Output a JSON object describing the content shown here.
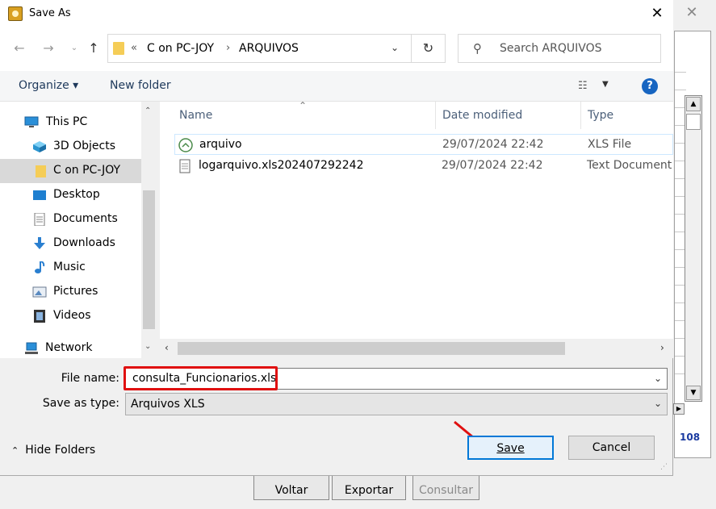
{
  "background_app": {
    "row_count": "108",
    "buttons": {
      "voltar": "Voltar",
      "exportar": "Exportar",
      "consultar": "Consultar"
    }
  },
  "dialog": {
    "title": "Save As",
    "address": {
      "overflow": "«",
      "crumbs": [
        "C on PC-JOY",
        "ARQUIVOS"
      ]
    },
    "search_placeholder": "Search ARQUIVOS",
    "toolbar": {
      "organize": "Organize ▾",
      "new_folder": "New folder"
    },
    "nav_items": [
      {
        "label": "This PC",
        "icon": "computer-icon"
      },
      {
        "label": "3D Objects",
        "icon": "cube-icon"
      },
      {
        "label": "C on PC-JOY",
        "icon": "folder-icon",
        "selected": true
      },
      {
        "label": "Desktop",
        "icon": "desktop-icon"
      },
      {
        "label": "Documents",
        "icon": "documents-icon"
      },
      {
        "label": "Downloads",
        "icon": "download-arrow-icon"
      },
      {
        "label": "Music",
        "icon": "music-note-icon"
      },
      {
        "label": "Pictures",
        "icon": "pictures-icon"
      },
      {
        "label": "Videos",
        "icon": "film-icon"
      },
      {
        "label": "Network",
        "icon": "network-icon"
      }
    ],
    "columns": {
      "name": "Name",
      "date": "Date modified",
      "type": "Type"
    },
    "files": [
      {
        "name": "arquivo",
        "date": "29/07/2024 22:42",
        "type": "XLS File",
        "icon": "xls-file-icon"
      },
      {
        "name": "logarquivo.xls202407292242",
        "date": "29/07/2024 22:42",
        "type": "Text Document",
        "icon": "text-file-icon"
      }
    ],
    "file_name_label": "File name:",
    "file_name_value": "consulta_Funcionarios.xls",
    "save_as_type_label": "Save as type:",
    "save_as_type_value": "Arquivos XLS",
    "hide_folders": "Hide Folders",
    "save_label": "Save",
    "cancel_label": "Cancel"
  },
  "colors": {
    "accent": "#0078d7",
    "highlight": "#e01010",
    "help": "#1765c1",
    "folder": "#f5cd57"
  }
}
